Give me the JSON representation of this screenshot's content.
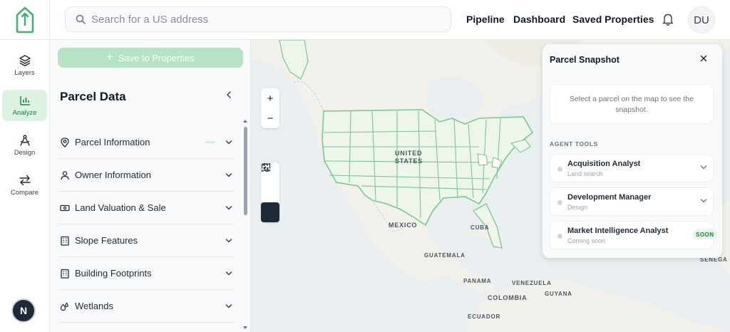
{
  "header": {
    "search_placeholder": "Search for a US address",
    "nav": [
      "Pipeline",
      "Dashboard",
      "Saved Properties"
    ],
    "avatar_initials": "DU"
  },
  "rail": {
    "items": [
      {
        "label": "Layers",
        "icon": "layers-icon"
      },
      {
        "label": "Analyze",
        "icon": "bar-chart-icon",
        "active": true
      },
      {
        "label": "Design",
        "icon": "compass-icon"
      },
      {
        "label": "Compare",
        "icon": "swap-arrows-icon"
      }
    ],
    "badge_letter": "N"
  },
  "panel": {
    "save_label": "Save to Properties",
    "title": "Parcel Data",
    "sections": [
      {
        "label": "Parcel Information",
        "icon": "map-pin-icon"
      },
      {
        "label": "Owner Information",
        "icon": "user-icon"
      },
      {
        "label": "Land Valuation & Sale",
        "icon": "banknote-icon"
      },
      {
        "label": "Slope Features",
        "icon": "building-icon"
      },
      {
        "label": "Building Footprints",
        "icon": "building-icon"
      },
      {
        "label": "Wetlands",
        "icon": "droplets-icon"
      }
    ]
  },
  "map": {
    "labels": {
      "usa_line1": "UNITED",
      "usa_line2": "STATES",
      "mexico": "MEXICO",
      "cuba": "CUBA",
      "guatemala": "GUATEMALA",
      "panama": "PANAMA",
      "venezuela": "VENEZUELA",
      "guyana": "GUYANA",
      "colombia": "COLOMBIA",
      "ecuador": "ECUADOR",
      "senegal": "SENEGA"
    },
    "zoom_in": "+",
    "zoom_out": "−"
  },
  "snapshot": {
    "title": "Parcel Snapshot",
    "empty_text": "Select a parcel on the map to see the snapshot.",
    "agent_tools_heading": "AGENT TOOLS",
    "agents": [
      {
        "name": "Acquisition Analyst",
        "sub": "Land search"
      },
      {
        "name": "Development Manager",
        "sub": "Design"
      },
      {
        "name": "Market Intelligence Analyst",
        "sub": "Coming soon",
        "badge": "SOON"
      }
    ]
  },
  "colors": {
    "accent": "#22a05a",
    "state_fill": "#eef5ea",
    "state_stroke": "#7cc88e"
  }
}
